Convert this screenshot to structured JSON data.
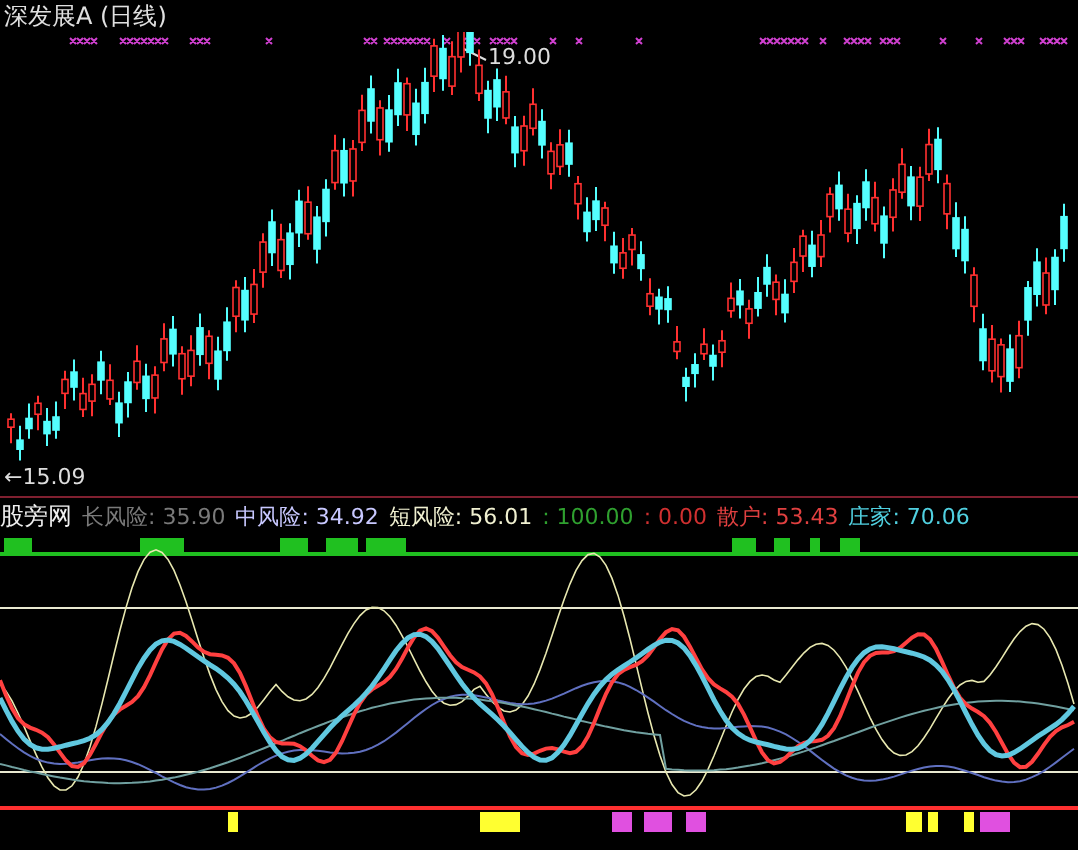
{
  "title": "深发展A (日线)",
  "price_pane": {
    "high_label": "19.00",
    "low_label": "←15.09"
  },
  "indicator": {
    "name": "股旁网",
    "values": [
      {
        "label": "长风险: 35.90",
        "color": "#7a7a7a"
      },
      {
        "label": "中风险: 34.92",
        "color": "#c8c8ff"
      },
      {
        "label": "短风险: 56.01",
        "color": "#f0f0d0"
      },
      {
        "label": ": 100.00",
        "color": "#2fa02f"
      },
      {
        "label": ": 0.00",
        "color": "#d03030"
      },
      {
        "label": "散户: 53.43",
        "color": "#e04040"
      },
      {
        "label": "庄家: 70.06",
        "color": "#50d0e0"
      }
    ]
  }
}
